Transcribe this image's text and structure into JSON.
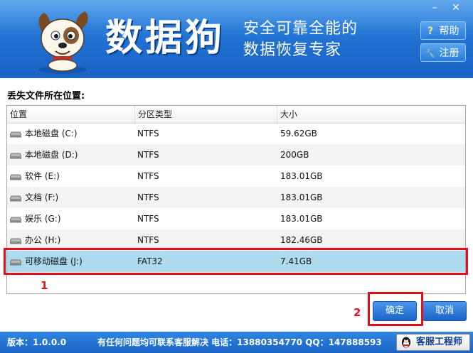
{
  "header": {
    "title": "数据狗",
    "slogan_line1": "安全可靠全能的",
    "slogan_line2": "数据恢复专家",
    "help_label": "帮助",
    "register_label": "注册",
    "minimize_glyph": "–",
    "close_glyph": "✕",
    "help_icon_glyph": "?",
    "register_icon_glyph": "🔧"
  },
  "main": {
    "section_label": "丢失文件所在位置:",
    "columns": [
      "位置",
      "分区类型",
      "大小"
    ],
    "rows": [
      {
        "name": "本地磁盘 (C:)",
        "type": "NTFS",
        "size": "59.62GB"
      },
      {
        "name": "本地磁盘 (D:)",
        "type": "NTFS",
        "size": "200GB"
      },
      {
        "name": "软件 (E:)",
        "type": "NTFS",
        "size": "183.01GB"
      },
      {
        "name": "文档 (F:)",
        "type": "NTFS",
        "size": "183.01GB"
      },
      {
        "name": "娱乐 (G:)",
        "type": "NTFS",
        "size": "183.01GB"
      },
      {
        "name": "办公 (H:)",
        "type": "NTFS",
        "size": "182.46GB"
      },
      {
        "name": "可移动磁盘 (J:)",
        "type": "FAT32",
        "size": "7.41GB"
      }
    ],
    "selected_index": 6,
    "marker1": "1",
    "marker2": "2",
    "ok_label": "确定",
    "cancel_label": "取消"
  },
  "footer": {
    "version": "版本：1.0.0.0",
    "contact": "有任何问题均可联系客服解决 电话：13880354770 QQ：147888593",
    "cs_label": "客服工程师"
  },
  "colors": {
    "header_blue": "#1e6fd1",
    "selected_row": "#aedaf0",
    "annotation_red": "#e0101c"
  }
}
